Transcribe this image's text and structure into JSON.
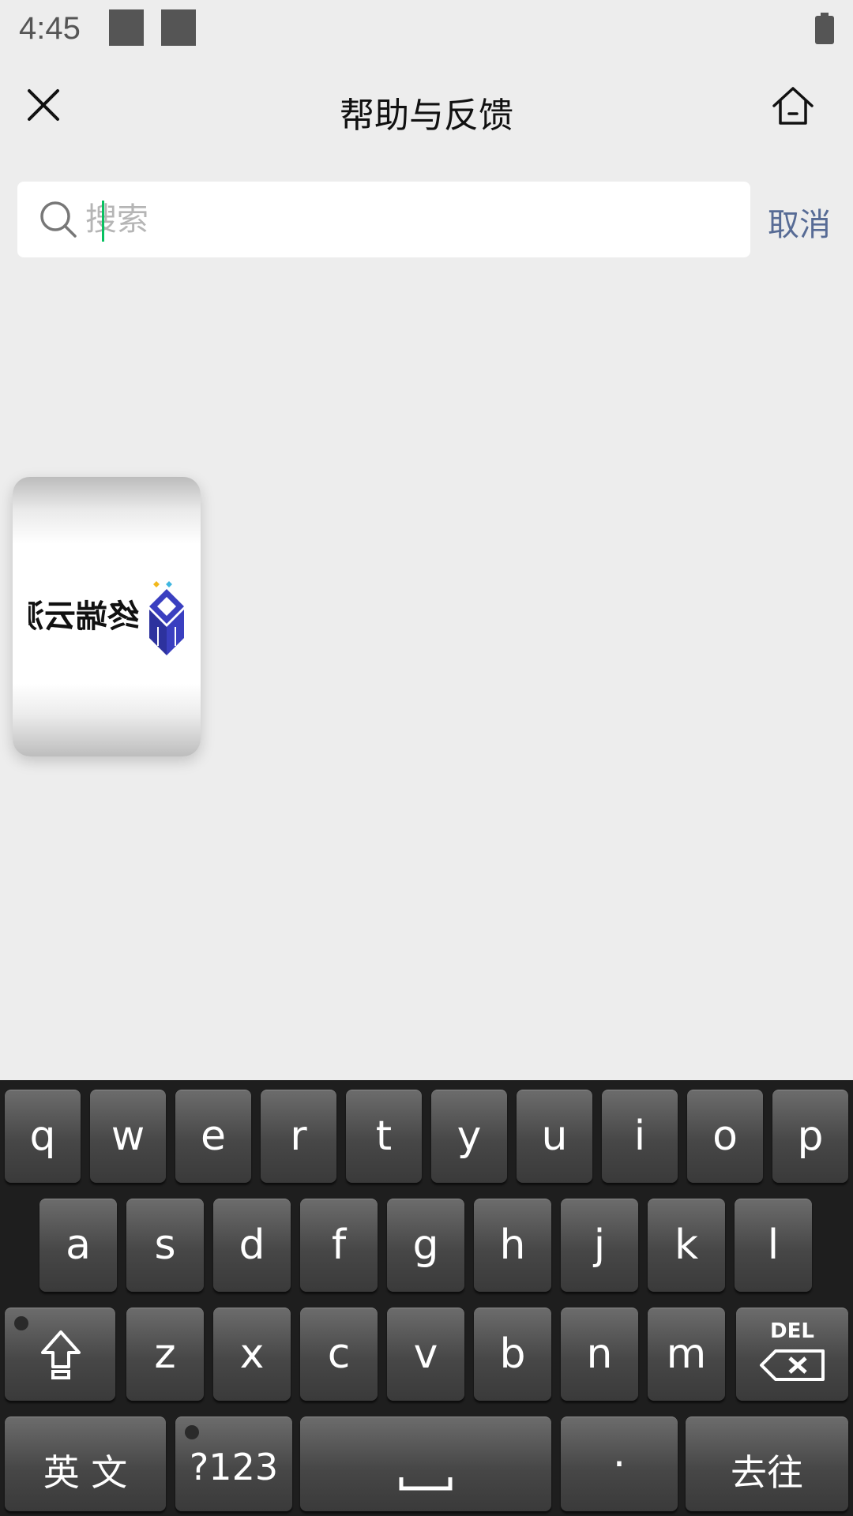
{
  "status_bar": {
    "time": "4:45",
    "battery_icon": "battery-icon"
  },
  "header": {
    "title": "帮助与反馈",
    "close_icon": "close-icon",
    "home_icon": "home-icon"
  },
  "search": {
    "placeholder": "搜索",
    "value": "",
    "cancel_label": "取消",
    "icon": "search-icon"
  },
  "floating_card": {
    "logo_text": "终端云测",
    "logo_mirrored": true
  },
  "keyboard": {
    "row1": [
      "q",
      "w",
      "e",
      "r",
      "t",
      "y",
      "u",
      "i",
      "o",
      "p"
    ],
    "row2": [
      "a",
      "s",
      "d",
      "f",
      "g",
      "h",
      "j",
      "k",
      "l"
    ],
    "row3": [
      "z",
      "x",
      "c",
      "v",
      "b",
      "n",
      "m"
    ],
    "shift_icon": "shift-icon",
    "del_label": "DEL",
    "lang_label": "英 文",
    "symbols_label": "?123",
    "space_icon": "space-icon",
    "period_label": "·",
    "go_label": "去往"
  }
}
